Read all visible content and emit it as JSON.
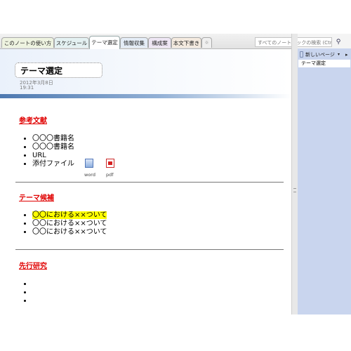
{
  "tabs": [
    {
      "label": "このノートの使い方",
      "color": "#eef3e0"
    },
    {
      "label": "スケジュール",
      "color": "#e4f1f2"
    },
    {
      "label": "テーマ選定",
      "color": "#ffffff"
    },
    {
      "label": "情報収集",
      "color": "#e4ecf6"
    },
    {
      "label": "構成案",
      "color": "#eee6f4"
    },
    {
      "label": "本文下書き",
      "color": "#f4eadf"
    },
    {
      "label": "☼",
      "color": "#efefef"
    }
  ],
  "search": {
    "placeholder": "すべてのノートブックの検索 (Ctrl+E)",
    "icon": "search-icon"
  },
  "page": {
    "title": "テーマ選定",
    "date": "2012年3月8日",
    "time": "19:31"
  },
  "sections": [
    {
      "heading": "参考文献",
      "items": [
        "〇〇〇書籍名",
        "〇〇〇書籍名",
        "URL",
        "添付ファイル"
      ],
      "attachments": [
        {
          "label": "word",
          "icon": "word-doc-icon"
        },
        {
          "label": "pdf",
          "icon": "pdf-doc-icon"
        }
      ]
    },
    {
      "heading": "テーマ候補",
      "items": [
        "〇〇における××ついて",
        "〇〇における××ついて",
        "〇〇における××ついて"
      ],
      "highlight_color": "#ffff00"
    },
    {
      "heading": "先行研究",
      "items": [
        "",
        "",
        ""
      ]
    }
  ],
  "sidebar": {
    "new_page_label": "新しいページ",
    "new_page_arrow": "▾",
    "pane_arrow": "▸",
    "pages": [
      "テーマ選定"
    ]
  },
  "colors": {
    "heading_red": "#e00000",
    "accent_blue": "#4e79b0",
    "pane_background": "#c9d5ee"
  }
}
